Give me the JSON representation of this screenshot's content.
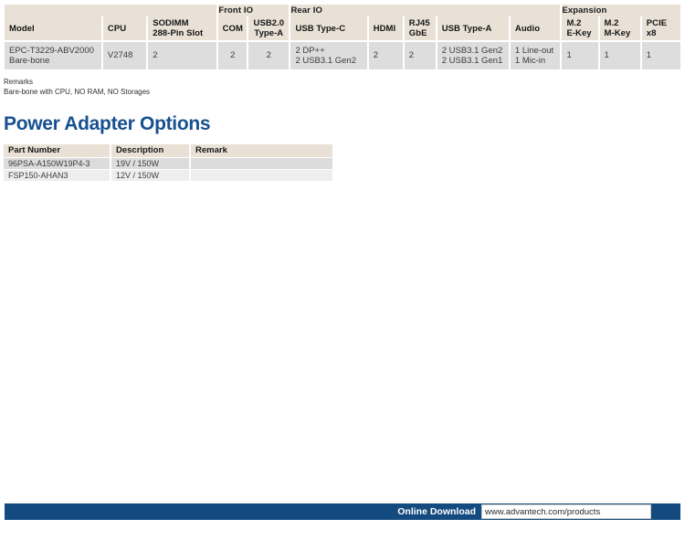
{
  "spec_table": {
    "group_headers": [
      {
        "label": "",
        "span": 3
      },
      {
        "label": "Front IO",
        "span": 2
      },
      {
        "label": "Rear IO",
        "span": 5
      },
      {
        "label": "Expansion",
        "span": 3
      }
    ],
    "columns": [
      {
        "label": "Model",
        "align": "left"
      },
      {
        "label": "CPU",
        "align": "left"
      },
      {
        "label": "SODIMM\n288-Pin Slot",
        "line1": "SODIMM",
        "line2": "288-Pin Slot",
        "align": "left"
      },
      {
        "label": "COM",
        "align": "center"
      },
      {
        "label": "USB2.0\nType-A",
        "line1": "USB2.0",
        "line2": "Type-A",
        "align": "center"
      },
      {
        "label": "USB Type-C",
        "align": "left"
      },
      {
        "label": "HDMI",
        "align": "left"
      },
      {
        "label": "RJ45\nGbE",
        "line1": "RJ45",
        "line2": "GbE",
        "align": "left"
      },
      {
        "label": "USB Type-A",
        "align": "left"
      },
      {
        "label": "Audio",
        "align": "left"
      },
      {
        "label": "M.2\nE-Key",
        "line1": "M.2",
        "line2": "E-Key",
        "align": "left"
      },
      {
        "label": "M.2\nM-Key",
        "line1": "M.2",
        "line2": "M-Key",
        "align": "left"
      },
      {
        "label": "PCIE\nx8",
        "line1": "PCIE",
        "line2": "x8",
        "align": "left"
      }
    ],
    "rows": [
      {
        "model_line1": "EPC-T3229-ABV2000",
        "model_line2": "Bare-bone",
        "cpu": "V2748",
        "sodimm": "2",
        "com": "2",
        "usb20_type_a": "2",
        "usb_type_c_line1": "2 DP++",
        "usb_type_c_line2": "2 USB3.1 Gen2",
        "hdmi": "2",
        "rj45_gbe": "2",
        "usb_type_a_line1": "2 USB3.1 Gen2",
        "usb_type_a_line2": "2 USB3.1 Gen1",
        "audio_line1": "1 Line-out",
        "audio_line2": "1 Mic-in",
        "m2_ekey": "1",
        "m2_mkey": "1",
        "pcie_x8": "1"
      }
    ]
  },
  "remarks": {
    "title": "Remarks",
    "text": "Bare-bone with CPU, NO RAM, NO Storages"
  },
  "section": {
    "title": "Power Adapter Options",
    "title_color": "#17508f"
  },
  "power_adapter_table": {
    "columns": [
      "Part Number",
      "Description",
      "Remark"
    ],
    "rows": [
      {
        "part_number": "96PSA-A150W19P4-3",
        "description": "19V / 150W",
        "remark": ""
      },
      {
        "part_number": "FSP150-AHAN3",
        "description": "12V / 150W",
        "remark": ""
      }
    ]
  },
  "footer": {
    "label": "Online Download",
    "url": "www.advantech.com/products",
    "bar_color": "#134a7f"
  }
}
